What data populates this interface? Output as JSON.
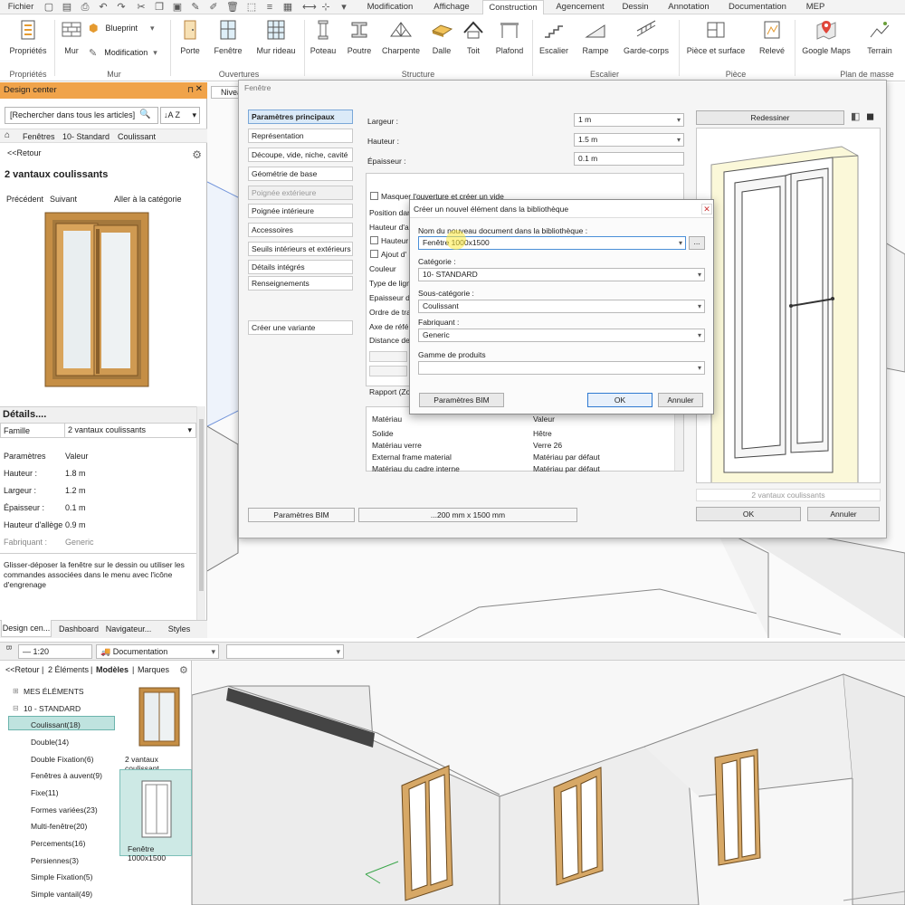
{
  "top_tabs": {
    "fichier": "Fichier",
    "items": [
      "Modification",
      "Affichage",
      "Construction",
      "Agencement",
      "Dessin",
      "Annotation",
      "Documentation",
      "MEP"
    ],
    "active": "Construction"
  },
  "ribbon": {
    "proprietes": "Propriétés",
    "mur": "Mur",
    "blueprint": "Blueprint",
    "modification": "Modification",
    "porte": "Porte",
    "fenetre": "Fenêtre",
    "mur_rideau": "Mur rideau",
    "poteau": "Poteau",
    "poutre": "Poutre",
    "charpente": "Charpente",
    "dalle": "Dalle",
    "toit": "Toit",
    "plafond": "Plafond",
    "escalier": "Escalier",
    "rampe": "Rampe",
    "garde_corps": "Garde-corps",
    "piece_surface": "Pièce et surface",
    "releve": "Relevé",
    "google_maps": "Google Maps",
    "terrain": "Terrain",
    "groups": {
      "proprietes": "Propriétés",
      "mur": "Mur",
      "ouvertures": "Ouvertures",
      "structure": "Structure",
      "escalier": "Escalier",
      "piece": "Pièce",
      "plan_masse": "Plan de masse"
    }
  },
  "design_center": {
    "title": "Design center",
    "search_placeholder": "[Rechercher dans tous les articles]",
    "breadcrumb": [
      "Fenêtres",
      "10- Standard",
      "Coulissant"
    ],
    "back": "<<Retour",
    "item_title": "2 vantaux coulissants",
    "prev": "Précédent",
    "next": "Suivant",
    "category_link": "Aller à la catégorie",
    "details_title": "Détails....",
    "famille_label": "Famille",
    "famille_value": "2 vantaux coulissants",
    "params_header": "Paramètres",
    "value_header": "Valeur",
    "params": [
      {
        "name": "Hauteur :",
        "value": "1.8 m"
      },
      {
        "name": "Largeur :",
        "value": "1.2 m"
      },
      {
        "name": "Épaisseur :",
        "value": "0.1 m"
      },
      {
        "name": "Hauteur d'allège",
        "value": "0.9 m"
      },
      {
        "name": "Fabriquant :",
        "value": "Generic"
      }
    ],
    "help_text": "Glisser-déposer la fenêtre sur le dessin ou utiliser les commandes associées dans le menu avec l'icône d'engrenage",
    "bottom_tabs": [
      "Design cen...",
      "Dashboard",
      "Navigateur...",
      "Styles"
    ]
  },
  "view_tab": "Nivea",
  "fenetre_dialog": {
    "title": "Fenêtre",
    "nav": [
      "Paramètres principaux",
      "Représentation",
      "Découpe, vide, niche, cavité",
      "Géométrie de base",
      "Poignée extérieure",
      "Poignée intérieure",
      "Accessoires",
      "Seuils intérieurs et extérieurs",
      "Détails intégrés",
      "Renseignements"
    ],
    "create_variant": "Créer une variante",
    "largeur_label": "Largeur :",
    "largeur_value": "1 m",
    "hauteur_label": "Hauteur :",
    "hauteur_value": "1.5 m",
    "epaisseur_label": "Épaisseur :",
    "epaisseur_value": "0.1 m",
    "checkbox_masquer": "Masquer l'ouverture et créer un vide",
    "left_labels": [
      "Position dans",
      "Hauteur d'all",
      "Hauteur",
      "Ajout d'",
      "Couleur",
      "Type de ligne",
      "Epaisseur de",
      "Ordre de trac",
      "Axe de référ",
      "Distance de l"
    ],
    "rapport": "Rapport (Zon",
    "materials": [
      {
        "name": "Matériau",
        "value": "Valeur"
      },
      {
        "name": "Solide",
        "value": "Hêtre"
      },
      {
        "name": "Matériau verre",
        "value": "Verre 26"
      },
      {
        "name": "External frame material",
        "value": "Matériau par défaut"
      },
      {
        "name": "Matériau du cadre interne",
        "value": "Matériau par défaut"
      }
    ],
    "redessiner": "Redessiner",
    "preview_caption": "2 vantaux coulissants",
    "bim_button": "Paramètres BIM",
    "size_button": "...200 mm x 1500 mm",
    "ok": "OK",
    "cancel": "Annuler"
  },
  "new_item_dialog": {
    "title": "Créer un nouvel élément dans la bibliothèque",
    "name_label": "Nom du nouveau document dans la bibliothèque :",
    "name_value": "Fenêtre 1000x1500",
    "browse": "...",
    "category_label": "Catégorie :",
    "category_value": "10- STANDARD",
    "subcategory_label": "Sous-catégorie :",
    "subcategory_value": "Coulissant",
    "maker_label": "Fabriquant :",
    "maker_value": "Generic",
    "range_label": "Gamme de produits",
    "range_value": "",
    "bim_button": "Paramètres BIM",
    "ok": "OK",
    "cancel": "Annuler"
  },
  "bottom_toolbar": {
    "scale": "1:20",
    "layer": "Documentation"
  },
  "bottom_panel": {
    "back": "<<Retour",
    "count": "2 Éléments",
    "models": "Modèles",
    "marques": "Marques",
    "tree_root1": "MES ÉLÉMENTS",
    "tree_root2": "10 - STANDARD",
    "items": [
      "Coulissant(18)",
      "Double(14)",
      "Double Fixation(6)",
      "Fenêtres à auvent(9)",
      "Fixe(11)",
      "Formes variées(23)",
      "Multi-fenêtre(20)",
      "Percements(16)",
      "Persiennes(3)",
      "Simple Fixation(5)",
      "Simple vantail(49)"
    ],
    "thumb1": "2 vantaux coulissant",
    "thumb2": "Fenêtre 1000x1500"
  },
  "colors": {
    "accent": "#f0a34a",
    "selection": "#bfe3df",
    "frame_wood": "#b8833f"
  }
}
